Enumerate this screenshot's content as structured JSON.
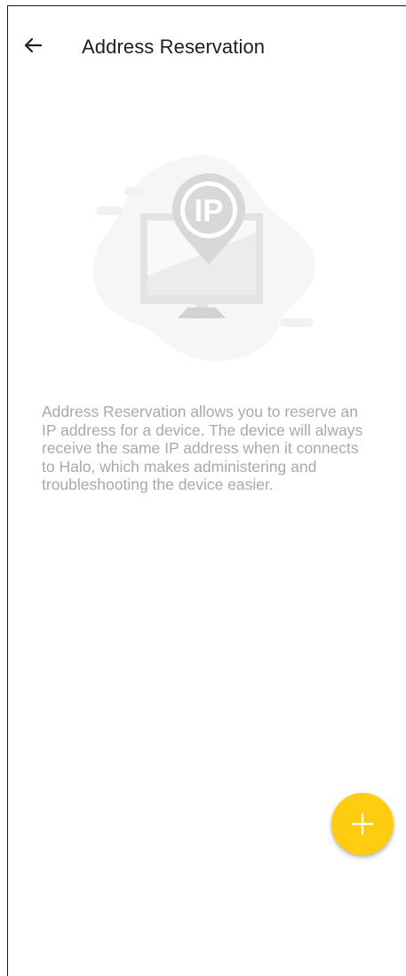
{
  "header": {
    "back_icon": "arrow-left-icon",
    "title": "Address Reservation"
  },
  "empty_state": {
    "illustration_icon": "ip-address-monitor-icon",
    "illustration_text": "IP",
    "description": "Address Reservation allows you to reserve an IP address for a device. The device will always receive the same IP address when it connects to Halo, which makes administering and troubleshooting the device easier."
  },
  "fab": {
    "icon": "plus-icon",
    "color": "#FFCD0F"
  },
  "colors": {
    "title": "#202020",
    "description": "#A9A9A9",
    "illustration": "#DADADA"
  }
}
